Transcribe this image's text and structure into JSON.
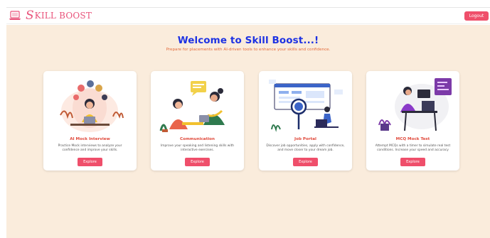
{
  "header": {
    "brand_icon": "laptop-icon",
    "brand_letter": "S",
    "brand_text": "KILL BOOST",
    "logout_label": "Logout"
  },
  "hero": {
    "title": "Welcome to Skill Boost...!",
    "subtitle": "Prepare for placements with AI-driven tools to enhance your skills and confidence."
  },
  "cards": [
    {
      "title": "AI Mock Interview",
      "description": "Practice Mock interviews to analyze your confidence and improve your skills.",
      "button_label": "Explore",
      "illustration": "interview-illustration"
    },
    {
      "title": "Communication",
      "description": "Improve your speaking and listening skills with interactive exercises.",
      "button_label": "Explore",
      "illustration": "communication-illustration"
    },
    {
      "title": "Job Portal",
      "description": "Discover job opportunities, apply with confidence, and move closer to your dream job.",
      "button_label": "Explore",
      "illustration": "job-search-illustration"
    },
    {
      "title": "MCQ Mock Test",
      "description": "Attempt MCQs with a timer to simulate real test conditions. Increase your speed and accuracy",
      "button_label": "Explore",
      "illustration": "developer-desk-illustration"
    }
  ],
  "colors": {
    "brand": "#e9527a",
    "accent_button": "#ef4f6b",
    "hero_title": "#1d32e3",
    "hero_subtitle": "#e36b3b",
    "card_title": "#e0493b",
    "page_background": "#faecdc"
  }
}
